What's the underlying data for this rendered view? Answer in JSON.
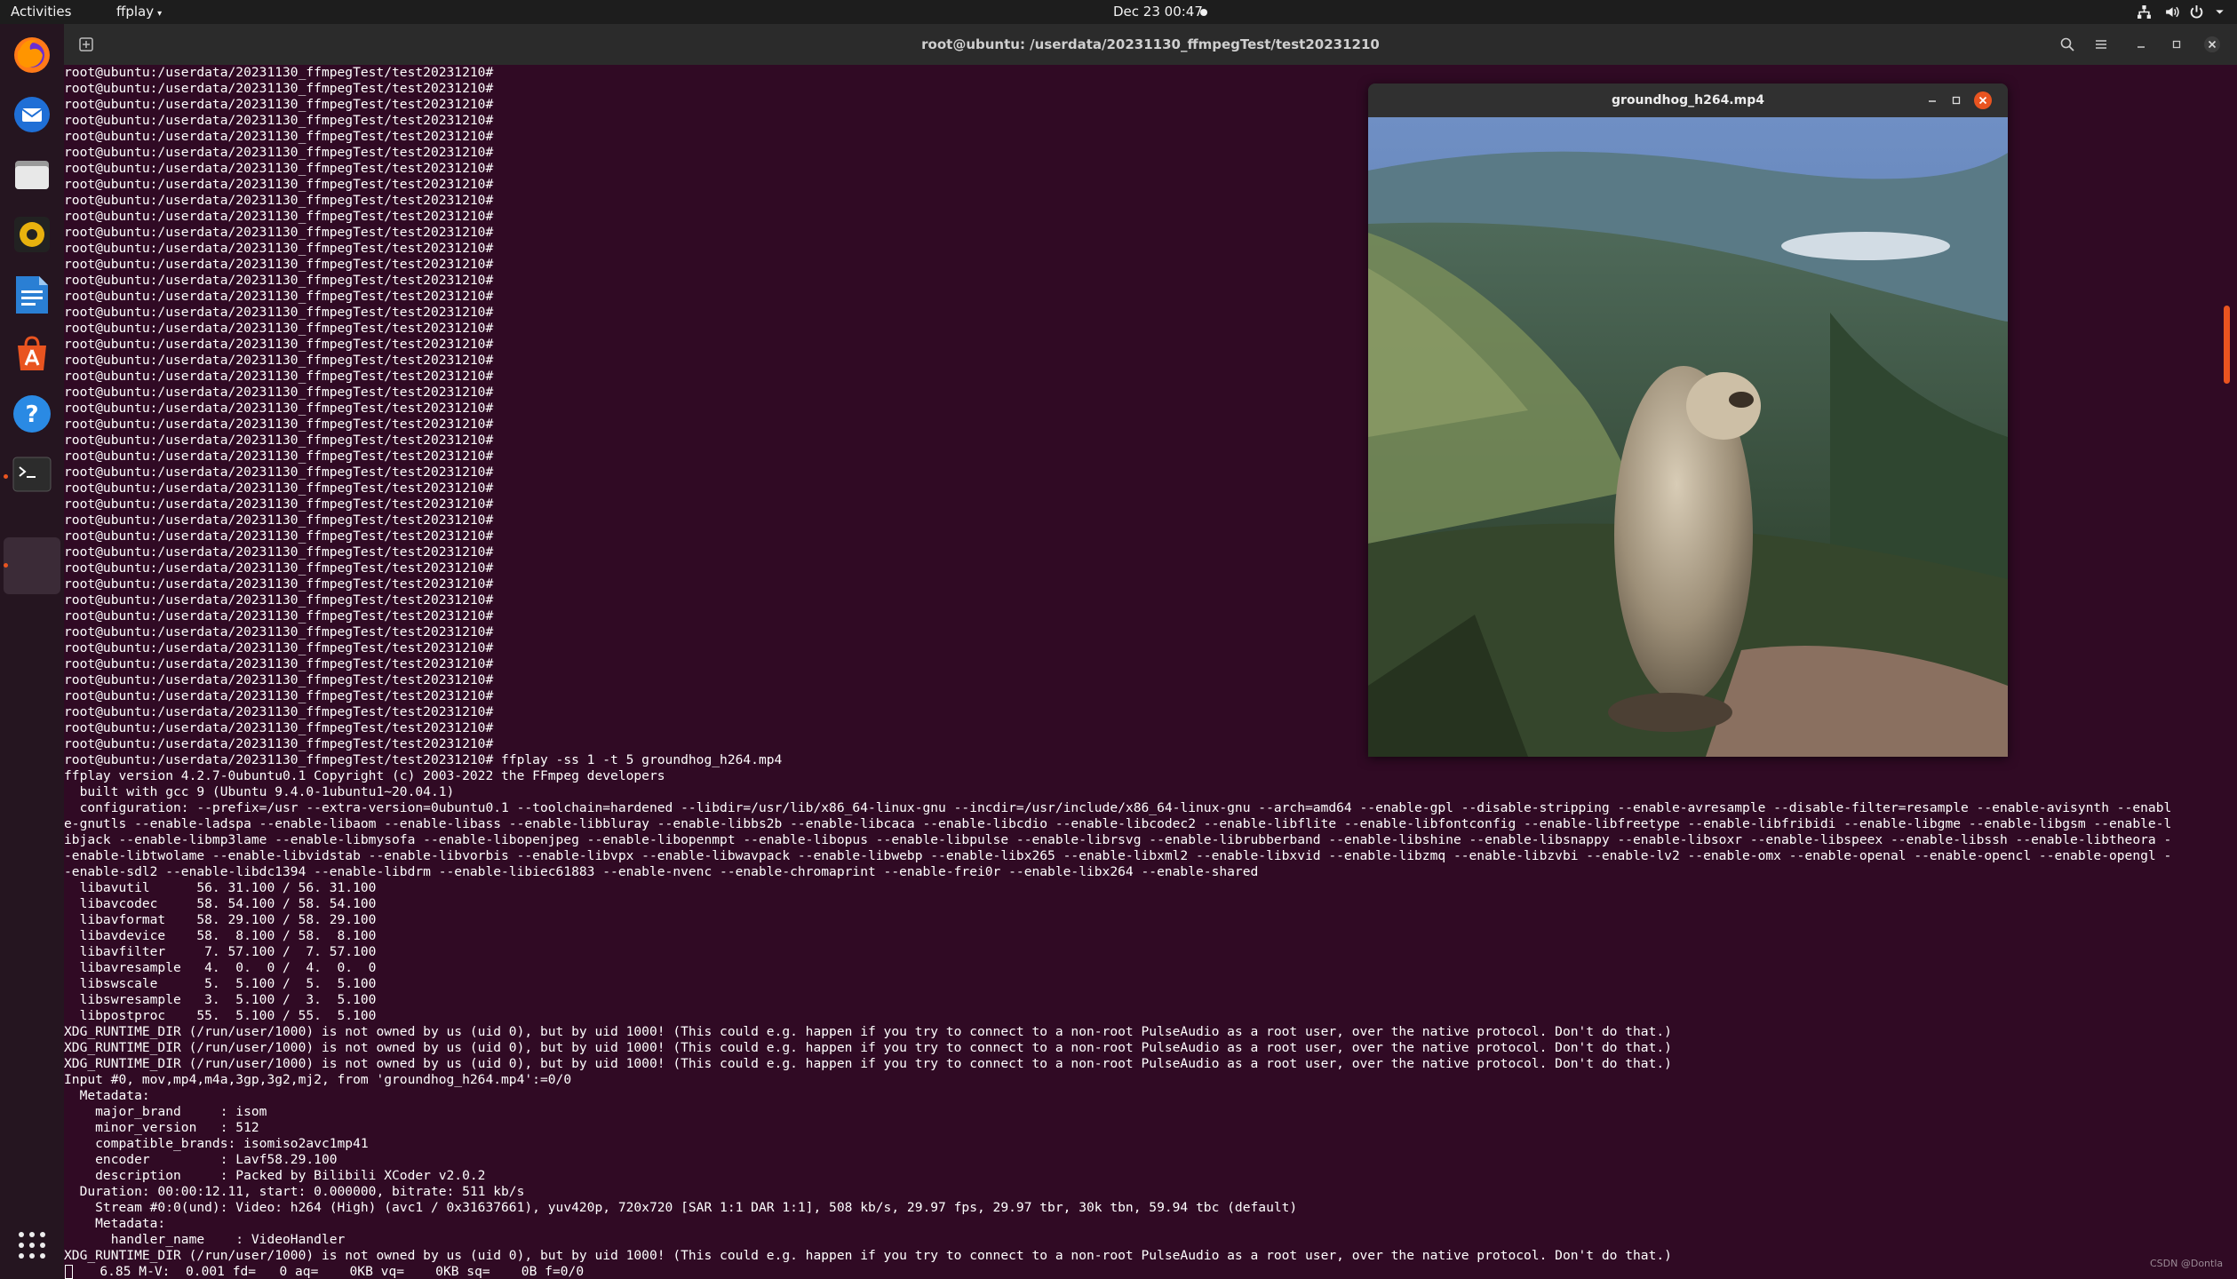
{
  "topbar": {
    "activities": "Activities",
    "app_menu": "ffplay",
    "clock": "Dec 23  00:47"
  },
  "terminal": {
    "title": "root@ubuntu: /userdata/20231130_ffmpegTest/test20231210",
    "lines": [
      "root@ubuntu:/userdata/20231130_ffmpegTest/test20231210#",
      "root@ubuntu:/userdata/20231130_ffmpegTest/test20231210#",
      "root@ubuntu:/userdata/20231130_ffmpegTest/test20231210#",
      "root@ubuntu:/userdata/20231130_ffmpegTest/test20231210#",
      "root@ubuntu:/userdata/20231130_ffmpegTest/test20231210#",
      "root@ubuntu:/userdata/20231130_ffmpegTest/test20231210#",
      "root@ubuntu:/userdata/20231130_ffmpegTest/test20231210#",
      "root@ubuntu:/userdata/20231130_ffmpegTest/test20231210#",
      "root@ubuntu:/userdata/20231130_ffmpegTest/test20231210#",
      "root@ubuntu:/userdata/20231130_ffmpegTest/test20231210#",
      "root@ubuntu:/userdata/20231130_ffmpegTest/test20231210#",
      "root@ubuntu:/userdata/20231130_ffmpegTest/test20231210#",
      "root@ubuntu:/userdata/20231130_ffmpegTest/test20231210#",
      "root@ubuntu:/userdata/20231130_ffmpegTest/test20231210#",
      "root@ubuntu:/userdata/20231130_ffmpegTest/test20231210#",
      "root@ubuntu:/userdata/20231130_ffmpegTest/test20231210#",
      "root@ubuntu:/userdata/20231130_ffmpegTest/test20231210#",
      "root@ubuntu:/userdata/20231130_ffmpegTest/test20231210#",
      "root@ubuntu:/userdata/20231130_ffmpegTest/test20231210#",
      "root@ubuntu:/userdata/20231130_ffmpegTest/test20231210#",
      "root@ubuntu:/userdata/20231130_ffmpegTest/test20231210#",
      "root@ubuntu:/userdata/20231130_ffmpegTest/test20231210#",
      "root@ubuntu:/userdata/20231130_ffmpegTest/test20231210#",
      "root@ubuntu:/userdata/20231130_ffmpegTest/test20231210#",
      "root@ubuntu:/userdata/20231130_ffmpegTest/test20231210#",
      "root@ubuntu:/userdata/20231130_ffmpegTest/test20231210#",
      "root@ubuntu:/userdata/20231130_ffmpegTest/test20231210#",
      "root@ubuntu:/userdata/20231130_ffmpegTest/test20231210#",
      "root@ubuntu:/userdata/20231130_ffmpegTest/test20231210#",
      "root@ubuntu:/userdata/20231130_ffmpegTest/test20231210#",
      "root@ubuntu:/userdata/20231130_ffmpegTest/test20231210#",
      "root@ubuntu:/userdata/20231130_ffmpegTest/test20231210#",
      "root@ubuntu:/userdata/20231130_ffmpegTest/test20231210#",
      "root@ubuntu:/userdata/20231130_ffmpegTest/test20231210#",
      "root@ubuntu:/userdata/20231130_ffmpegTest/test20231210#",
      "root@ubuntu:/userdata/20231130_ffmpegTest/test20231210#",
      "root@ubuntu:/userdata/20231130_ffmpegTest/test20231210#",
      "root@ubuntu:/userdata/20231130_ffmpegTest/test20231210#",
      "root@ubuntu:/userdata/20231130_ffmpegTest/test20231210#",
      "root@ubuntu:/userdata/20231130_ffmpegTest/test20231210#",
      "root@ubuntu:/userdata/20231130_ffmpegTest/test20231210#",
      "root@ubuntu:/userdata/20231130_ffmpegTest/test20231210#",
      "root@ubuntu:/userdata/20231130_ffmpegTest/test20231210#",
      "root@ubuntu:/userdata/20231130_ffmpegTest/test20231210# ffplay -ss 1 -t 5 groundhog_h264.mp4",
      "ffplay version 4.2.7-0ubuntu0.1 Copyright (c) 2003-2022 the FFmpeg developers",
      "  built with gcc 9 (Ubuntu 9.4.0-1ubuntu1~20.04.1)",
      "  configuration: --prefix=/usr --extra-version=0ubuntu0.1 --toolchain=hardened --libdir=/usr/lib/x86_64-linux-gnu --incdir=/usr/include/x86_64-linux-gnu --arch=amd64 --enable-gpl --disable-stripping --enable-avresample --disable-filter=resample --enable-avisynth --enabl",
      "e-gnutls --enable-ladspa --enable-libaom --enable-libass --enable-libbluray --enable-libbs2b --enable-libcaca --enable-libcdio --enable-libcodec2 --enable-libflite --enable-libfontconfig --enable-libfreetype --enable-libfribidi --enable-libgme --enable-libgsm --enable-l",
      "ibjack --enable-libmp3lame --enable-libmysofa --enable-libopenjpeg --enable-libopenmpt --enable-libopus --enable-libpulse --enable-librsvg --enable-librubberband --enable-libshine --enable-libsnappy --enable-libsoxr --enable-libspeex --enable-libssh --enable-libtheora -",
      "-enable-libtwolame --enable-libvidstab --enable-libvorbis --enable-libvpx --enable-libwavpack --enable-libwebp --enable-libx265 --enable-libxml2 --enable-libxvid --enable-libzmq --enable-libzvbi --enable-lv2 --enable-omx --enable-openal --enable-opencl --enable-opengl -",
      "-enable-sdl2 --enable-libdc1394 --enable-libdrm --enable-libiec61883 --enable-nvenc --enable-chromaprint --enable-frei0r --enable-libx264 --enable-shared",
      "  libavutil      56. 31.100 / 56. 31.100",
      "  libavcodec     58. 54.100 / 58. 54.100",
      "  libavformat    58. 29.100 / 58. 29.100",
      "  libavdevice    58.  8.100 / 58.  8.100",
      "  libavfilter     7. 57.100 /  7. 57.100",
      "  libavresample   4.  0.  0 /  4.  0.  0",
      "  libswscale      5.  5.100 /  5.  5.100",
      "  libswresample   3.  5.100 /  3.  5.100",
      "  libpostproc    55.  5.100 / 55.  5.100",
      "XDG_RUNTIME_DIR (/run/user/1000) is not owned by us (uid 0), but by uid 1000! (This could e.g. happen if you try to connect to a non-root PulseAudio as a root user, over the native protocol. Don't do that.)",
      "XDG_RUNTIME_DIR (/run/user/1000) is not owned by us (uid 0), but by uid 1000! (This could e.g. happen if you try to connect to a non-root PulseAudio as a root user, over the native protocol. Don't do that.)",
      "XDG_RUNTIME_DIR (/run/user/1000) is not owned by us (uid 0), but by uid 1000! (This could e.g. happen if you try to connect to a non-root PulseAudio as a root user, over the native protocol. Don't do that.)",
      "Input #0, mov,mp4,m4a,3gp,3g2,mj2, from 'groundhog_h264.mp4':=0/0",
      "  Metadata:",
      "    major_brand     : isom",
      "    minor_version   : 512",
      "    compatible_brands: isomiso2avc1mp41",
      "    encoder         : Lavf58.29.100",
      "    description     : Packed by Bilibili XCoder v2.0.2",
      "  Duration: 00:00:12.11, start: 0.000000, bitrate: 511 kb/s",
      "    Stream #0:0(und): Video: h264 (High) (avc1 / 0x31637661), yuv420p, 720x720 [SAR 1:1 DAR 1:1], 508 kb/s, 29.97 fps, 29.97 tbr, 30k tbn, 59.94 tbc (default)",
      "    Metadata:",
      "      handler_name    : VideoHandler",
      "XDG_RUNTIME_DIR (/run/user/1000) is not owned by us (uid 0), but by uid 1000! (This could e.g. happen if you try to connect to a non-root PulseAudio as a root user, over the native protocol. Don't do that.)",
      "   6.85 M-V:  0.001 fd=   0 aq=    0KB vq=    0KB sq=    0B f=0/0"
    ]
  },
  "ffplay": {
    "title": "groundhog_h264.mp4"
  },
  "watermark": "CSDN @Dontla",
  "colors": {
    "terminal_bg": "#300a24",
    "accent": "#e95420",
    "topbar_bg": "#1d1d1d",
    "dock_bg": "#251520"
  },
  "dock_icons": [
    "firefox-icon",
    "thunderbird-icon",
    "files-icon",
    "rhythmbox-icon",
    "writer-icon",
    "software-icon",
    "help-icon",
    "terminal-icon",
    "show-apps-icon"
  ],
  "tray_icons": [
    "network-icon",
    "volume-icon",
    "power-icon",
    "chevron-down-icon"
  ]
}
